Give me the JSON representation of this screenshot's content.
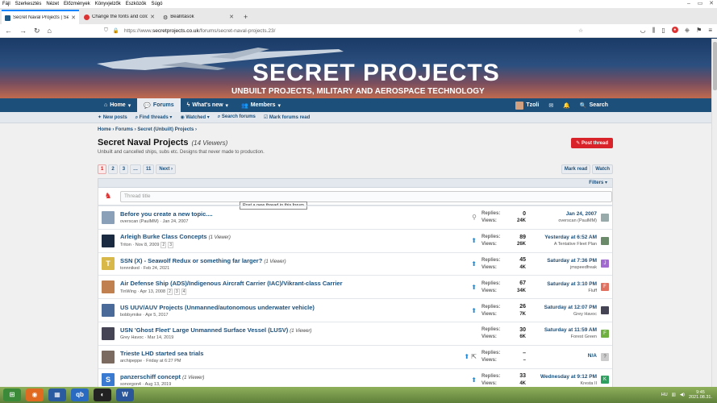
{
  "menubar": [
    "Fájl",
    "Szerkesztés",
    "Nézet",
    "Előzmények",
    "Könyvjelzők",
    "Eszközök",
    "Súgó"
  ],
  "tabs": [
    {
      "title": "Secret Naval Projects | Secret Pr",
      "active": true
    },
    {
      "title": "Change the fonts and colors w",
      "active": false
    },
    {
      "title": "Beállítások",
      "active": false
    }
  ],
  "url": {
    "prefix": "https://www.",
    "domain": "secretprojects.co.uk",
    "path": "/forums/secret-naval-projects.23/"
  },
  "banner": {
    "logo": "SECRET PROJECTS",
    "tagline": "UNBUILT PROJECTS, MILITARY AND AEROSPACE TECHNOLOGY"
  },
  "mainnav": {
    "home": "Home",
    "forums": "Forums",
    "whats_new": "What's new",
    "members": "Members",
    "user": "Tzoli",
    "search": "Search"
  },
  "subnav": [
    "New posts",
    "Find threads",
    "Watched",
    "Search forums",
    "Mark forums read"
  ],
  "breadcrumb": [
    "Home",
    "Forums",
    "Secret (Unbuilt) Projects"
  ],
  "page": {
    "title": "Secret Naval Projects",
    "viewers": "(14 Viewers)",
    "description": "Unbuilt and cancelled ships, subs etc. Designs that never made to production.",
    "post_thread": "Post thread",
    "mark_read": "Mark read",
    "watch": "Watch",
    "filters": "Filters",
    "thread_title_placeholder": "Thread title",
    "tooltip": "Post a new thread in this forum"
  },
  "pagination": {
    "pages": [
      "1",
      "2",
      "3",
      "…",
      "11"
    ],
    "next": "Next"
  },
  "labels": {
    "replies": "Replies:",
    "views": "Views:"
  },
  "threads": [
    {
      "title": "Before you create a new topic....",
      "viewers": "",
      "meta": "overscan (PaulMM) · Jan 24, 2007",
      "replies": "0",
      "views": "24K",
      "last_date": "Jan 24, 2007",
      "last_user": "overscan (PaulMM)",
      "avatar_color": "#8aa0b8",
      "avatar_letter": "",
      "last_color": "#9aa",
      "last_letter": "",
      "icon": "pin",
      "pages": []
    },
    {
      "title": "Arleigh Burke Class Concepts",
      "viewers": "(1 Viewer)",
      "meta": "Triton · Nov 8, 2009",
      "replies": "89",
      "views": "26K",
      "last_date": "Yesterday at 6:52 AM",
      "last_user": "A Tentative Fleet Plan",
      "avatar_color": "#1a2a40",
      "avatar_letter": "",
      "last_color": "#6a8a6a",
      "last_letter": "",
      "icon": "unread",
      "pages": [
        "2",
        "3"
      ]
    },
    {
      "title": "SSN (X) - Seawolf Redux or something far larger?",
      "viewers": "(1 Viewer)",
      "meta": "tonnniked · Feb 24, 2021",
      "replies": "45",
      "views": "4K",
      "last_date": "Saturday at 7:36 PM",
      "last_user": "jmspeedfreak",
      "avatar_color": "#d9b84a",
      "avatar_letter": "T",
      "last_color": "#a06ad0",
      "last_letter": "J",
      "icon": "unread",
      "pages": []
    },
    {
      "title": "Air Defense Ship (ADS)/Indigenous Aircraft Carrier (IAC)/Vikrant-class Carrier",
      "viewers": "",
      "meta": "TinWing · Apr 13, 2008",
      "replies": "67",
      "views": "34K",
      "last_date": "Saturday at 3:10 PM",
      "last_user": "Fluff",
      "avatar_color": "#c08050",
      "avatar_letter": "",
      "last_color": "#e07060",
      "last_letter": "F",
      "icon": "unread",
      "pages": [
        "2",
        "3",
        "4"
      ]
    },
    {
      "title": "US UUV/AUV Projects (Unmanned/autonomous underwater vehicle)",
      "viewers": "",
      "meta": "bobbymike · Apr 5, 2017",
      "replies": "26",
      "views": "7K",
      "last_date": "Saturday at 12:07 PM",
      "last_user": "Grey Havoc",
      "avatar_color": "#4a6a9a",
      "avatar_letter": "",
      "last_color": "#445",
      "last_letter": "",
      "icon": "unread",
      "pages": []
    },
    {
      "title": "USN 'Ghost Fleet' Large Unmanned Surface Vessel (LUSV)",
      "viewers": "(1 Viewer)",
      "meta": "Grey Havoc · Mar 14, 2019",
      "replies": "30",
      "views": "6K",
      "last_date": "Saturday at 11:59 AM",
      "last_user": "Forest Green",
      "avatar_color": "#445",
      "avatar_letter": "",
      "last_color": "#70b040",
      "last_letter": "F",
      "icon": "",
      "pages": []
    },
    {
      "title": "Trieste LHD started sea trials",
      "viewers": "",
      "meta": "archipeppe · Friday at 6:27 PM",
      "replies": "–",
      "views": "–",
      "last_date": "N/A",
      "last_user": "",
      "avatar_color": "#7a6a60",
      "avatar_letter": "",
      "last_color": "#ccc",
      "last_letter": "?",
      "icon": "unread-edit",
      "pages": []
    },
    {
      "title": "panzerschiff concept",
      "viewers": "(1 Viewer)",
      "meta": "sonorgon4 · Aug 13, 2019",
      "replies": "33",
      "views": "4K",
      "last_date": "Wednesday at 9:12 PM",
      "last_user": "Kresta II",
      "avatar_color": "#3a7ad0",
      "avatar_letter": "S",
      "last_color": "#30a060",
      "last_letter": "K",
      "icon": "unread",
      "pages": []
    }
  ],
  "tray": {
    "lang": "HU",
    "time": "9:45",
    "date": "2021.08.31."
  }
}
